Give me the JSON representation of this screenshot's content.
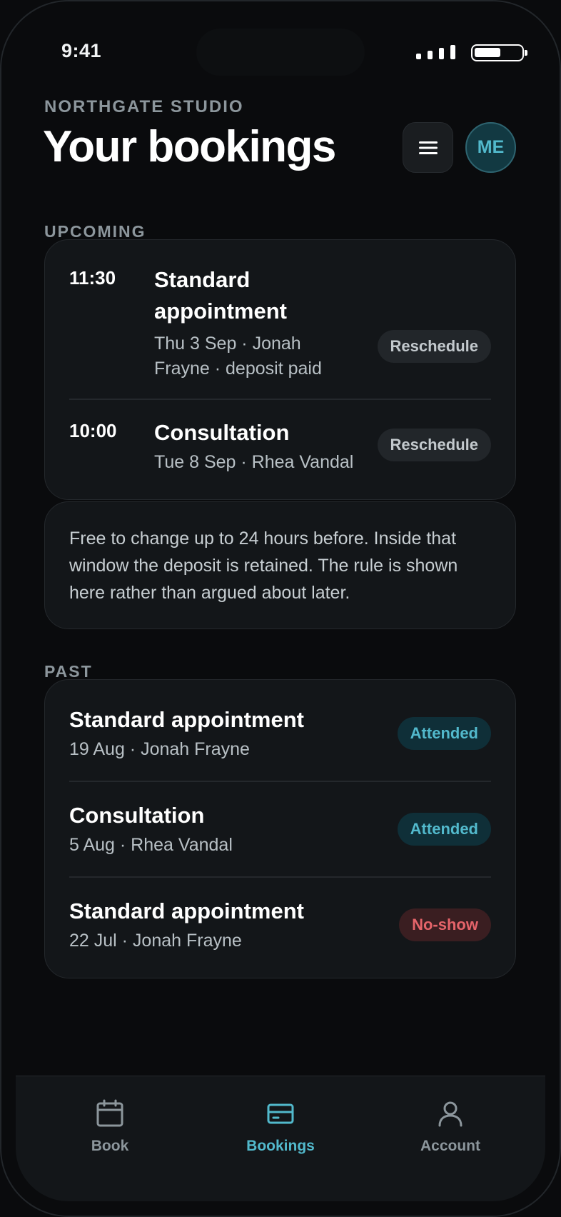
{
  "status_bar": {
    "time": "9:41"
  },
  "header": {
    "eyebrow": "NORTHGATE STUDIO",
    "title": "Your bookings",
    "avatar_initials": "ME"
  },
  "upcoming": {
    "label": "UPCOMING",
    "items": [
      {
        "time": "11:30",
        "title": "Standard appointment",
        "meta": "Thu 3 Sep · Jonah Frayne · deposit paid",
        "action": "Reschedule"
      },
      {
        "time": "10:00",
        "title": "Consultation",
        "meta": "Tue 8 Sep · Rhea Vandal",
        "action": "Reschedule"
      }
    ]
  },
  "policy": {
    "text": "Free to change up to 24 hours before. Inside that window the deposit is retained. The rule is shown here rather than argued about later."
  },
  "past": {
    "label": "PAST",
    "items": [
      {
        "title": "Standard appointment",
        "meta": "19 Aug · Jonah Frayne",
        "status": "Attended"
      },
      {
        "title": "Consultation",
        "meta": "5 Aug · Rhea Vandal",
        "status": "Attended"
      },
      {
        "title": "Standard appointment",
        "meta": "22 Jul · Jonah Frayne",
        "status": "No-show"
      }
    ]
  },
  "tab_bar": {
    "tabs": [
      {
        "label": "Book",
        "icon": "calendar-icon"
      },
      {
        "label": "Bookings",
        "icon": "ticket-icon",
        "active": true
      },
      {
        "label": "Account",
        "icon": "person-icon"
      }
    ]
  },
  "colors": {
    "background": "#0a0b0d",
    "card": "#131619",
    "accent": "#52b9cc",
    "danger": "#e5646a"
  }
}
